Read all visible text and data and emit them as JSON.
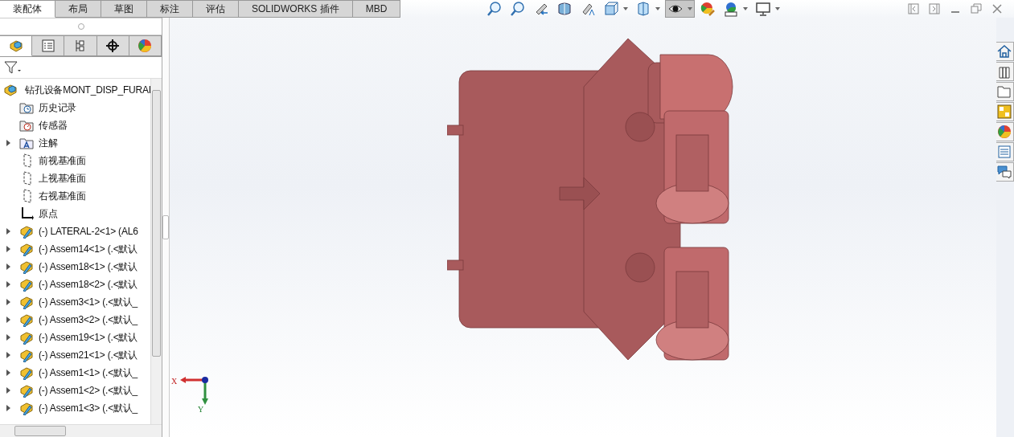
{
  "tabs": [
    {
      "label": "装配体",
      "selected": true
    },
    {
      "label": "布局",
      "selected": false
    },
    {
      "label": "草图",
      "selected": false
    },
    {
      "label": "标注",
      "selected": false
    },
    {
      "label": "评估",
      "selected": false
    },
    {
      "label": "SOLIDWORKS 插件",
      "selected": false
    },
    {
      "label": "MBD",
      "selected": false
    }
  ],
  "panel_tabs": [
    {
      "kind": "feature",
      "selected": true
    },
    {
      "kind": "property",
      "selected": false
    },
    {
      "kind": "config",
      "selected": false
    },
    {
      "kind": "dim",
      "selected": false
    },
    {
      "kind": "display",
      "selected": false
    }
  ],
  "tree": {
    "label": "钻孔设备MONT_DISP_FURAI",
    "children": [
      {
        "label": "历史记录",
        "kind": "history",
        "expandable": false
      },
      {
        "label": "传感器",
        "kind": "sensor",
        "expandable": false
      },
      {
        "label": "注解",
        "kind": "annotation",
        "expandable": true
      },
      {
        "label": "前视基准面",
        "kind": "plane",
        "expandable": false
      },
      {
        "label": "上视基准面",
        "kind": "plane",
        "expandable": false
      },
      {
        "label": "右视基准面",
        "kind": "plane",
        "expandable": false
      },
      {
        "label": "原点",
        "kind": "origin",
        "expandable": false
      },
      {
        "label": "(-) LATERAL-2<1> (AL6",
        "kind": "component",
        "expandable": true
      },
      {
        "label": "(-) Assem14<1> (.<默认",
        "kind": "component",
        "expandable": true
      },
      {
        "label": "(-) Assem18<1> (.<默认",
        "kind": "component",
        "expandable": true
      },
      {
        "label": "(-) Assem18<2> (.<默认",
        "kind": "component",
        "expandable": true
      },
      {
        "label": "(-) Assem3<1> (.<默认_",
        "kind": "component",
        "expandable": true
      },
      {
        "label": "(-) Assem3<2> (.<默认_",
        "kind": "component",
        "expandable": true
      },
      {
        "label": "(-) Assem19<1> (.<默认",
        "kind": "component",
        "expandable": true
      },
      {
        "label": "(-) Assem21<1> (.<默认",
        "kind": "component",
        "expandable": true
      },
      {
        "label": "(-) Assem1<1> (.<默认_",
        "kind": "component",
        "expandable": true
      },
      {
        "label": "(-) Assem1<2> (.<默认_",
        "kind": "component",
        "expandable": true
      },
      {
        "label": "(-) Assem1<3> (.<默认_",
        "kind": "component",
        "expandable": true
      }
    ]
  },
  "view_toolbar": [
    {
      "kind": "zoom-fit",
      "dropdown": false,
      "selected": false
    },
    {
      "kind": "zoom-area",
      "dropdown": false,
      "selected": false
    },
    {
      "kind": "previous",
      "dropdown": false,
      "selected": false
    },
    {
      "kind": "section",
      "dropdown": false,
      "selected": false
    },
    {
      "kind": "dynamic",
      "dropdown": false,
      "selected": false
    },
    {
      "kind": "orientation",
      "dropdown": true,
      "selected": false
    },
    {
      "kind": "display-style",
      "dropdown": true,
      "selected": false
    },
    {
      "kind": "hide-show",
      "dropdown": true,
      "selected": true
    },
    {
      "kind": "appearance",
      "dropdown": false,
      "selected": false
    },
    {
      "kind": "scene",
      "dropdown": true,
      "selected": false
    },
    {
      "kind": "monitor",
      "dropdown": true,
      "selected": false
    }
  ],
  "task_pane": [
    {
      "kind": "home"
    },
    {
      "kind": "library"
    },
    {
      "kind": "folder"
    },
    {
      "kind": "palette"
    },
    {
      "kind": "appearance"
    },
    {
      "kind": "properties"
    },
    {
      "kind": "forum"
    }
  ],
  "triad": {
    "x_label": "X",
    "y_label": "Y"
  }
}
